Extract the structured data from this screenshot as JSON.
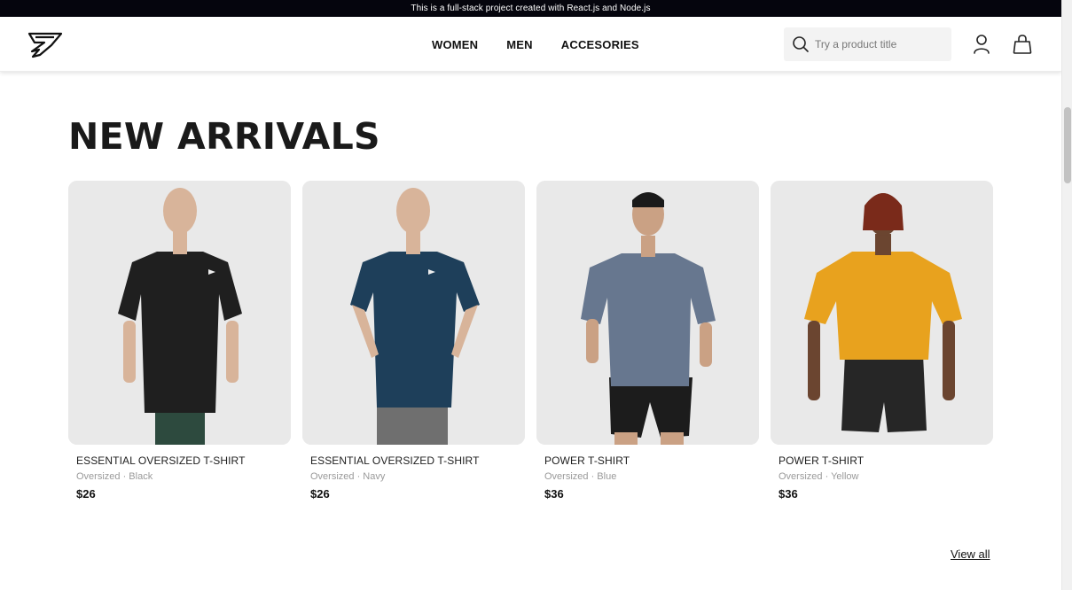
{
  "announcement": "This is a full-stack project created with React.js and Node.js",
  "header": {
    "nav": [
      "WOMEN",
      "MEN",
      "ACCESORIES"
    ],
    "search_placeholder": "Try a product title"
  },
  "section": {
    "title": "NEW ARRIVALS",
    "view_all": "View all"
  },
  "products": [
    {
      "name": "ESSENTIAL OVERSIZED T-SHIRT",
      "variant": "Oversized · Black",
      "price": "$26",
      "shirt_color": "#1f1f1f",
      "shorts_color": "#2d4a3e",
      "skin": "#d8b49a"
    },
    {
      "name": "ESSENTIAL OVERSIZED T-SHIRT",
      "variant": "Oversized · Navy",
      "price": "$26",
      "shirt_color": "#1e3f5a",
      "shorts_color": "#6f6f6f",
      "skin": "#d8b49a"
    },
    {
      "name": "POWER T-SHIRT",
      "variant": "Oversized · Blue",
      "price": "$36",
      "shirt_color": "#67778f",
      "shorts_color": "#1c1c1c",
      "skin": "#caa184"
    },
    {
      "name": "POWER T-SHIRT",
      "variant": "Oversized · Yellow",
      "price": "$36",
      "shirt_color": "#e8a21e",
      "shorts_color": "#262626",
      "skin": "#6b4530"
    }
  ],
  "icons": {
    "logo": "brand-logo-icon",
    "search": "search-icon",
    "user": "user-icon",
    "cart": "shopping-bag-icon"
  },
  "colors": {
    "announcement_bg": "#05050d",
    "card_bg": "#e8e8e8",
    "variant_text": "#9a9a9a"
  }
}
